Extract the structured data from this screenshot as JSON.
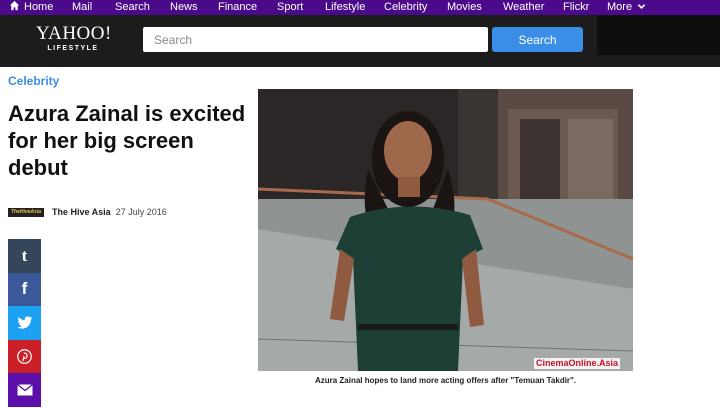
{
  "topnav": {
    "items": [
      "Home",
      "Mail",
      "Search",
      "News",
      "Finance",
      "Sport",
      "Lifestyle",
      "Celebrity",
      "Movies",
      "Weather",
      "Flickr",
      "More"
    ],
    "background": "#4a0a8a",
    "icons": {
      "home": "home-icon",
      "more": "chevron-down-icon"
    }
  },
  "header": {
    "logo_main": "YAHOO!",
    "logo_sub": "LIFESTYLE",
    "search_placeholder": "Search",
    "search_button": "Search",
    "accent": "#3b8ee6"
  },
  "article": {
    "category": "Celebrity",
    "headline": "Azura Zainal is excited for her big screen debut",
    "source_logo_text": "TheHiveAsia",
    "author": "The Hive Asia",
    "date": "27 July 2016",
    "photo_credit": "CinemaOnline.Asia",
    "caption": "Azura Zainal hopes to land more acting offers after \"Temuan Takdir\"."
  },
  "share": {
    "buttons": [
      {
        "name": "tumblr",
        "glyph": "t",
        "color": "#35465c"
      },
      {
        "name": "facebook",
        "glyph": "f",
        "color": "#3b5998"
      },
      {
        "name": "twitter",
        "glyph": "twitter-bird",
        "color": "#1da1f2"
      },
      {
        "name": "pinterest",
        "glyph": "pinterest-p",
        "color": "#cb2027"
      },
      {
        "name": "mail",
        "glyph": "envelope",
        "color": "#5b0fa8"
      }
    ]
  }
}
